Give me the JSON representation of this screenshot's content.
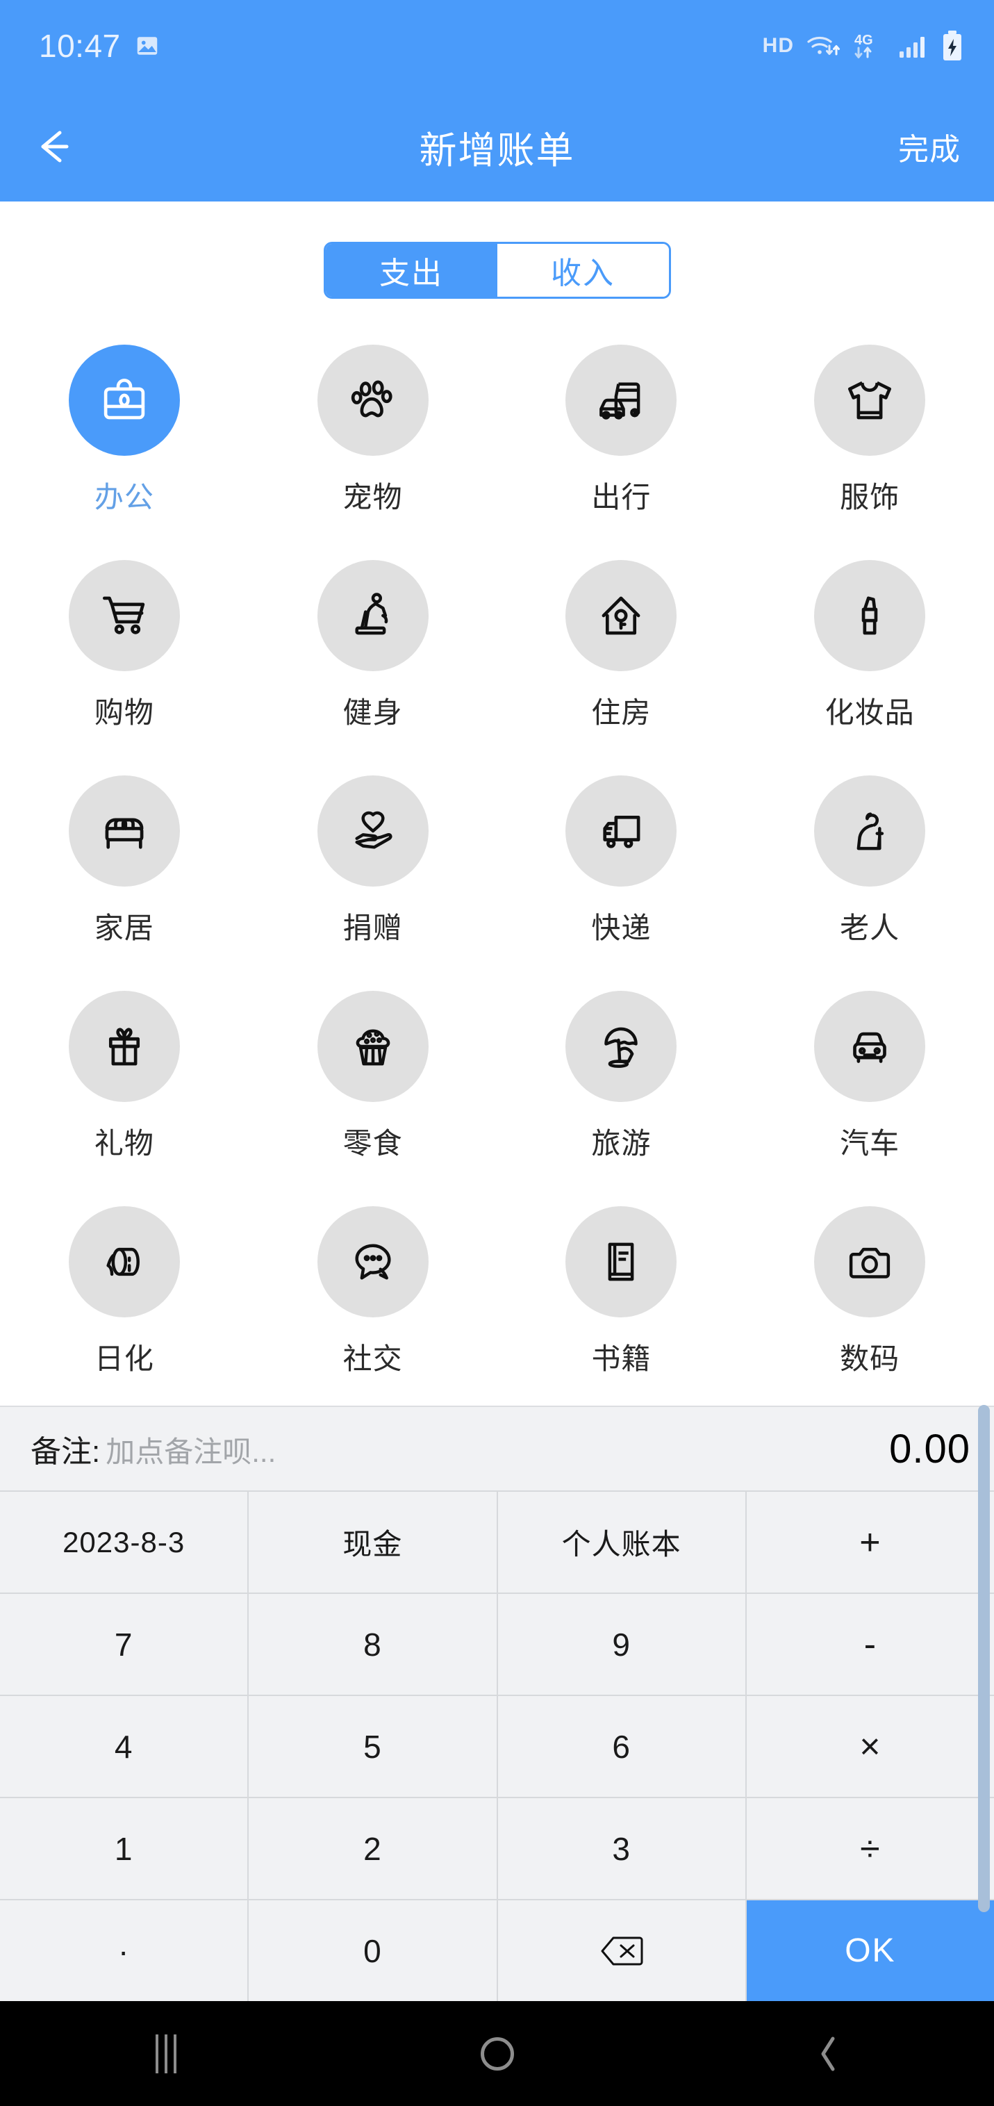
{
  "status_bar": {
    "time": "10:47",
    "icons": [
      "image-icon",
      "hd-icon",
      "wifi-icon",
      "4g-icon",
      "signal-icon",
      "battery-charging-icon"
    ],
    "hd_label": "HD",
    "network_label": "4G"
  },
  "header": {
    "back_icon": "back-arrow-icon",
    "title": "新增账单",
    "done_label": "完成",
    "accent_color": "#4a9bfa"
  },
  "segmented": {
    "options": [
      {
        "label": "支出",
        "selected": true
      },
      {
        "label": "收入",
        "selected": false
      }
    ]
  },
  "categories": [
    {
      "label": "办公",
      "icon": "briefcase-icon",
      "selected": true
    },
    {
      "label": "宠物",
      "icon": "paw-icon",
      "selected": false
    },
    {
      "label": "出行",
      "icon": "bus-car-icon",
      "selected": false
    },
    {
      "label": "服饰",
      "icon": "tshirt-icon",
      "selected": false
    },
    {
      "label": "购物",
      "icon": "shopping-cart-icon",
      "selected": false
    },
    {
      "label": "健身",
      "icon": "treadmill-icon",
      "selected": false
    },
    {
      "label": "住房",
      "icon": "house-key-icon",
      "selected": false
    },
    {
      "label": "化妆品",
      "icon": "lipstick-icon",
      "selected": false
    },
    {
      "label": "家居",
      "icon": "bed-icon",
      "selected": false
    },
    {
      "label": "捐赠",
      "icon": "heart-in-hand-icon",
      "selected": false
    },
    {
      "label": "快递",
      "icon": "delivery-truck-icon",
      "selected": false
    },
    {
      "label": "老人",
      "icon": "elderly-person-icon",
      "selected": false
    },
    {
      "label": "礼物",
      "icon": "gift-icon",
      "selected": false
    },
    {
      "label": "零食",
      "icon": "cupcake-icon",
      "selected": false
    },
    {
      "label": "旅游",
      "icon": "beach-umbrella-icon",
      "selected": false
    },
    {
      "label": "汽车",
      "icon": "car-icon",
      "selected": false
    },
    {
      "label": "日化",
      "icon": "toilet-paper-icon",
      "selected": false
    },
    {
      "label": "社交",
      "icon": "chat-bubbles-icon",
      "selected": false
    },
    {
      "label": "书籍",
      "icon": "book-icon",
      "selected": false
    },
    {
      "label": "数码",
      "icon": "camera-icon",
      "selected": false
    }
  ],
  "note_row": {
    "label": "备注:",
    "placeholder": "加点备注呗...",
    "amount": "0.00"
  },
  "keypad": {
    "rows": [
      [
        {
          "label": "2023-8-3",
          "name": "date-key",
          "kind": "meta"
        },
        {
          "label": "现金",
          "name": "payment-method-key",
          "kind": "meta"
        },
        {
          "label": "个人账本",
          "name": "ledger-key",
          "kind": "meta"
        },
        {
          "label": "+",
          "name": "plus-key",
          "kind": "op"
        }
      ],
      [
        {
          "label": "7",
          "name": "key-7",
          "kind": "num"
        },
        {
          "label": "8",
          "name": "key-8",
          "kind": "num"
        },
        {
          "label": "9",
          "name": "key-9",
          "kind": "num"
        },
        {
          "label": "-",
          "name": "minus-key",
          "kind": "op"
        }
      ],
      [
        {
          "label": "4",
          "name": "key-4",
          "kind": "num"
        },
        {
          "label": "5",
          "name": "key-5",
          "kind": "num"
        },
        {
          "label": "6",
          "name": "key-6",
          "kind": "num"
        },
        {
          "label": "×",
          "name": "multiply-key",
          "kind": "op"
        }
      ],
      [
        {
          "label": "1",
          "name": "key-1",
          "kind": "num"
        },
        {
          "label": "2",
          "name": "key-2",
          "kind": "num"
        },
        {
          "label": "3",
          "name": "key-3",
          "kind": "num"
        },
        {
          "label": "÷",
          "name": "divide-key",
          "kind": "op"
        }
      ],
      [
        {
          "label": "·",
          "name": "decimal-key",
          "kind": "num"
        },
        {
          "label": "0",
          "name": "key-0",
          "kind": "num"
        },
        {
          "label": "",
          "name": "backspace-key",
          "kind": "icon"
        },
        {
          "label": "OK",
          "name": "ok-key",
          "kind": "ok"
        }
      ]
    ]
  },
  "nav_bar": {
    "recents_label": "recents-icon",
    "home_label": "home-icon",
    "back_label": "back-icon"
  }
}
